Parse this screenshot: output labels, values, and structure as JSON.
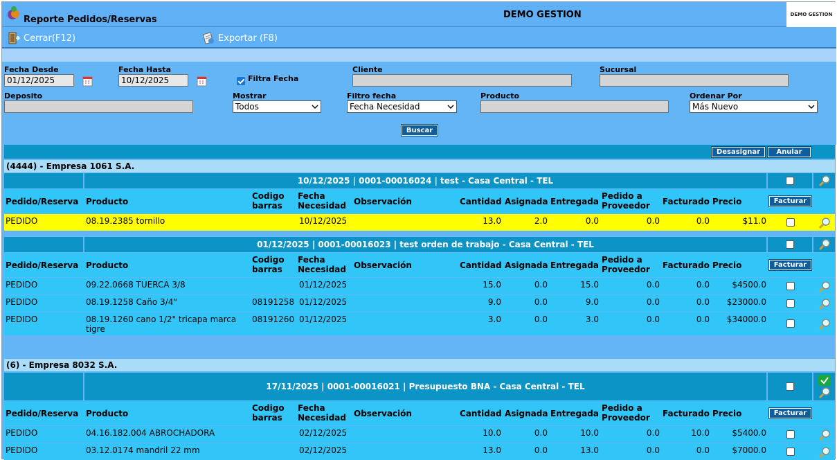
{
  "window": {
    "title": "Reporte Pedidos/Reservas",
    "center_title": "DEMO GESTION",
    "logo_text": "DEMO GESTION"
  },
  "toolbar": {
    "close_label": "Cerrar(F12)",
    "export_label": "Exportar (F8)"
  },
  "filters": {
    "fecha_desde_label": "Fecha Desde",
    "fecha_desde": "01/12/2025",
    "fecha_hasta_label": "Fecha Hasta",
    "fecha_hasta": "10/12/2025",
    "filtra_fecha_label": "Filtra Fecha",
    "filtra_fecha_checked": true,
    "cliente_label": "Cliente",
    "cliente": "",
    "sucursal_label": "Sucursal",
    "sucursal": "",
    "deposito_label": "Deposito",
    "deposito": "",
    "mostrar_label": "Mostrar",
    "mostrar": "Todos",
    "filtro_fecha_label": "Filtro fecha",
    "filtro_fecha": "Fecha Necesidad",
    "producto_label": "Producto",
    "producto": "",
    "ordenar_label": "Ordenar Por",
    "ordenar": "Más Nuevo",
    "buscar_label": "Buscar"
  },
  "actions": {
    "desasignar": "Desasignar",
    "anular": "Anular",
    "facturar": "Facturar"
  },
  "columns": {
    "pedido": "Pedido/Reserva",
    "producto": "Producto",
    "codigo1": "Codigo",
    "codigo2": "barras",
    "fecha1": "Fecha",
    "fecha2": "Necesidad",
    "observacion": "Observación",
    "cantidad": "Cantidad",
    "asignada": "Asignada",
    "entregada": "Entregada",
    "pedido_prov1": "Pedido a",
    "pedido_prov2": "Proveedor",
    "facturado": "Facturado",
    "precio": "Precio"
  },
  "companies": [
    {
      "name": "(4444) - Empresa 1061 S.A.",
      "orders": [
        {
          "header": "10/12/2025 | 0001-00016024 | test - Casa Central - TEL",
          "rows": [
            {
              "tipo": "PEDIDO",
              "producto": "08.19.2385 tornillo",
              "codigo": "",
              "fecha": "10/12/2025",
              "obs": "",
              "cantidad": "13.0",
              "asignada": "2.0",
              "entregada": "0.0",
              "pedido_prov": "0.0",
              "facturado": "0.0",
              "precio": "$11.0"
            }
          ]
        },
        {
          "header": "01/12/2025 | 0001-00016023 | test orden de trabajo - Casa Central - TEL",
          "rows": [
            {
              "tipo": "PEDIDO",
              "producto": "09.22.0668 TUERCA 3/8",
              "codigo": "",
              "fecha": "01/12/2025",
              "obs": "",
              "cantidad": "15.0",
              "asignada": "0.0",
              "entregada": "15.0",
              "pedido_prov": "0.0",
              "facturado": "0.0",
              "precio": "$4500.0"
            },
            {
              "tipo": "PEDIDO",
              "producto": "08.19.1258 Caño 3/4\"",
              "codigo": "08191258",
              "fecha": "01/12/2025",
              "obs": "",
              "cantidad": "9.0",
              "asignada": "0.0",
              "entregada": "9.0",
              "pedido_prov": "0.0",
              "facturado": "0.0",
              "precio": "$23000.0"
            },
            {
              "tipo": "PEDIDO",
              "producto_l1": "08.19.1260 cano 1/2\" tricapa marca",
              "producto_l2": "tigre",
              "codigo": "08191260",
              "fecha": "01/12/2025",
              "obs": "",
              "cantidad": "3.0",
              "asignada": "0.0",
              "entregada": "3.0",
              "pedido_prov": "0.0",
              "facturado": "0.0",
              "precio": "$34000.0"
            }
          ]
        }
      ]
    },
    {
      "name": "(6) - Empresa 8032 S.A.",
      "orders": [
        {
          "header": "17/11/2025 | 0001-00016021 | Presupuesto BNA - Casa Central - TEL",
          "rows": [
            {
              "tipo": "PEDIDO",
              "producto": "04.16.182.004 ABROCHADORA",
              "codigo": "",
              "fecha": "02/12/2025",
              "obs": "",
              "cantidad": "10.0",
              "asignada": "0.0",
              "entregada": "10.0",
              "pedido_prov": "0.0",
              "facturado": "10.0",
              "precio": "$5400.0"
            },
            {
              "tipo": "PEDIDO",
              "producto": "03.12.0174 mandril 22 mm",
              "codigo": "",
              "fecha": "02/12/2025",
              "obs": "",
              "cantidad": "13.0",
              "asignada": "0.0",
              "entregada": "13.0",
              "pedido_prov": "0.0",
              "facturado": "0.0",
              "precio": "$7000.0"
            }
          ]
        }
      ]
    }
  ]
}
